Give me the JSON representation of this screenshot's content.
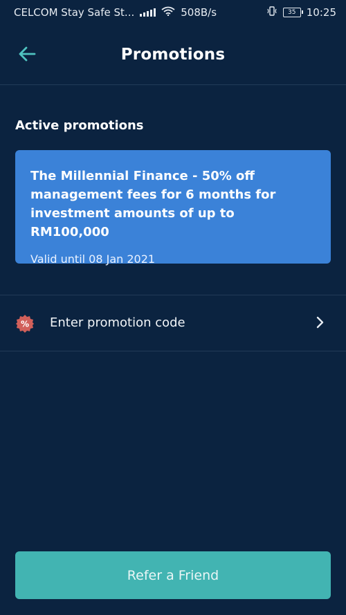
{
  "status_bar": {
    "carrier": "CELCOM Stay Safe St...",
    "speed": "508B/s",
    "battery": "35",
    "time": "10:25"
  },
  "header": {
    "title": "Promotions"
  },
  "active": {
    "title": "Active promotions",
    "promos": [
      {
        "title": "The Millennial Finance - 50% off management fees for 6 months for investment amounts of up to RM100,000",
        "valid": "Valid until 08 Jan 2021"
      }
    ]
  },
  "promo_code": {
    "label": "Enter promotion code",
    "badge_symbol": "%"
  },
  "refer": {
    "label": "Refer a Friend"
  },
  "colors": {
    "background": "#0b2340",
    "card": "#3b82d8",
    "accent": "#42b4b2",
    "back_arrow": "#4fc3c0",
    "badge": "#d1605a"
  }
}
